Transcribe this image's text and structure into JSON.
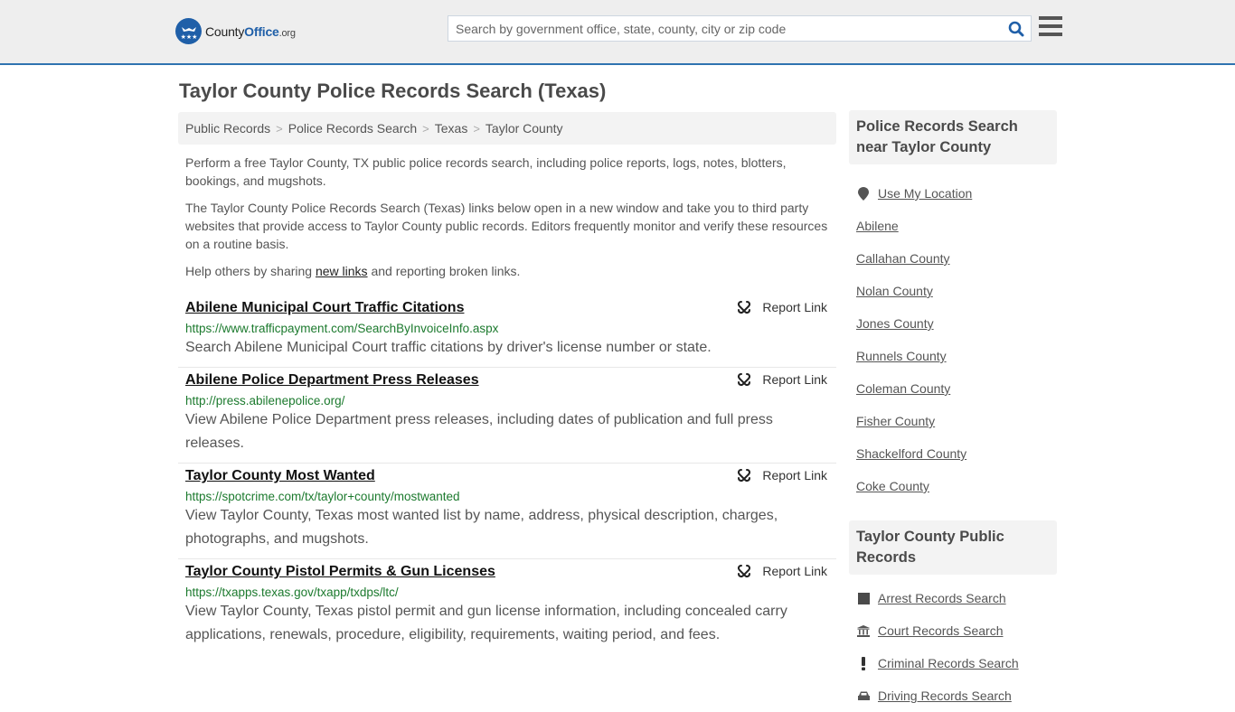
{
  "header": {
    "logo": {
      "county": "County",
      "office": "Office",
      "org": ".org"
    },
    "search": {
      "placeholder": "Search by government office, state, county, city or zip code",
      "value": ""
    },
    "colors": {
      "brand_blue": "#1f5fa8",
      "topbar_bg": "#eeeeee",
      "url_green": "#1c7a2e"
    }
  },
  "page": {
    "title": "Taylor County Police Records Search (Texas)",
    "breadcrumb": [
      {
        "label": "Public Records"
      },
      {
        "label": "Police Records Search"
      },
      {
        "label": "Texas"
      },
      {
        "label": "Taylor County"
      }
    ],
    "breadcrumb_separator": ">",
    "intro": {
      "p1": "Perform a free Taylor County, TX public police records search, including police reports, logs, notes, blotters, bookings, and mugshots.",
      "p2": "The Taylor County Police Records Search (Texas) links below open in a new window and take you to third party websites that provide access to Taylor County public records. Editors frequently monitor and verify these resources on a routine basis.",
      "p3_before": "Help others by sharing ",
      "p3_link": "new links",
      "p3_after": " and reporting broken links."
    }
  },
  "results": [
    {
      "title": "Abilene Municipal Court Traffic Citations",
      "url": "https://www.trafficpayment.com/SearchByInvoiceInfo.aspx",
      "description": "Search Abilene Municipal Court traffic citations by driver's license number or state.",
      "report_label": "Report Link"
    },
    {
      "title": "Abilene Police Department Press Releases",
      "url": "http://press.abilenepolice.org/",
      "description": "View Abilene Police Department press releases, including dates of publication and full press releases.",
      "report_label": "Report Link"
    },
    {
      "title": "Taylor County Most Wanted",
      "url": "https://spotcrime.com/tx/taylor+county/mostwanted",
      "description": "View Taylor County, Texas most wanted list by name, address, physical description, charges, photographs, and mugshots.",
      "report_label": "Report Link"
    },
    {
      "title": "Taylor County Pistol Permits & Gun Licenses",
      "url": "https://txapps.texas.gov/txapp/txdps/ltc/",
      "description": "View Taylor County, Texas pistol permit and gun license information, including concealed carry applications, renewals, procedure, eligibility, requirements, waiting period, and fees.",
      "report_label": "Report Link"
    }
  ],
  "sidebar": {
    "nearby": {
      "heading": "Police Records Search near Taylor County",
      "use_location": "Use My Location",
      "items": [
        "Abilene",
        "Callahan County",
        "Nolan County",
        "Jones County",
        "Runnels County",
        "Coleman County",
        "Fisher County",
        "Shackelford County",
        "Coke County"
      ]
    },
    "public_records": {
      "heading": "Taylor County Public Records",
      "items": [
        {
          "label": "Arrest Records Search",
          "icon": "square-icon"
        },
        {
          "label": "Court Records Search",
          "icon": "courthouse-icon"
        },
        {
          "label": "Criminal Records Search",
          "icon": "exclamation-icon"
        },
        {
          "label": "Driving Records Search",
          "icon": "car-icon"
        }
      ]
    }
  }
}
